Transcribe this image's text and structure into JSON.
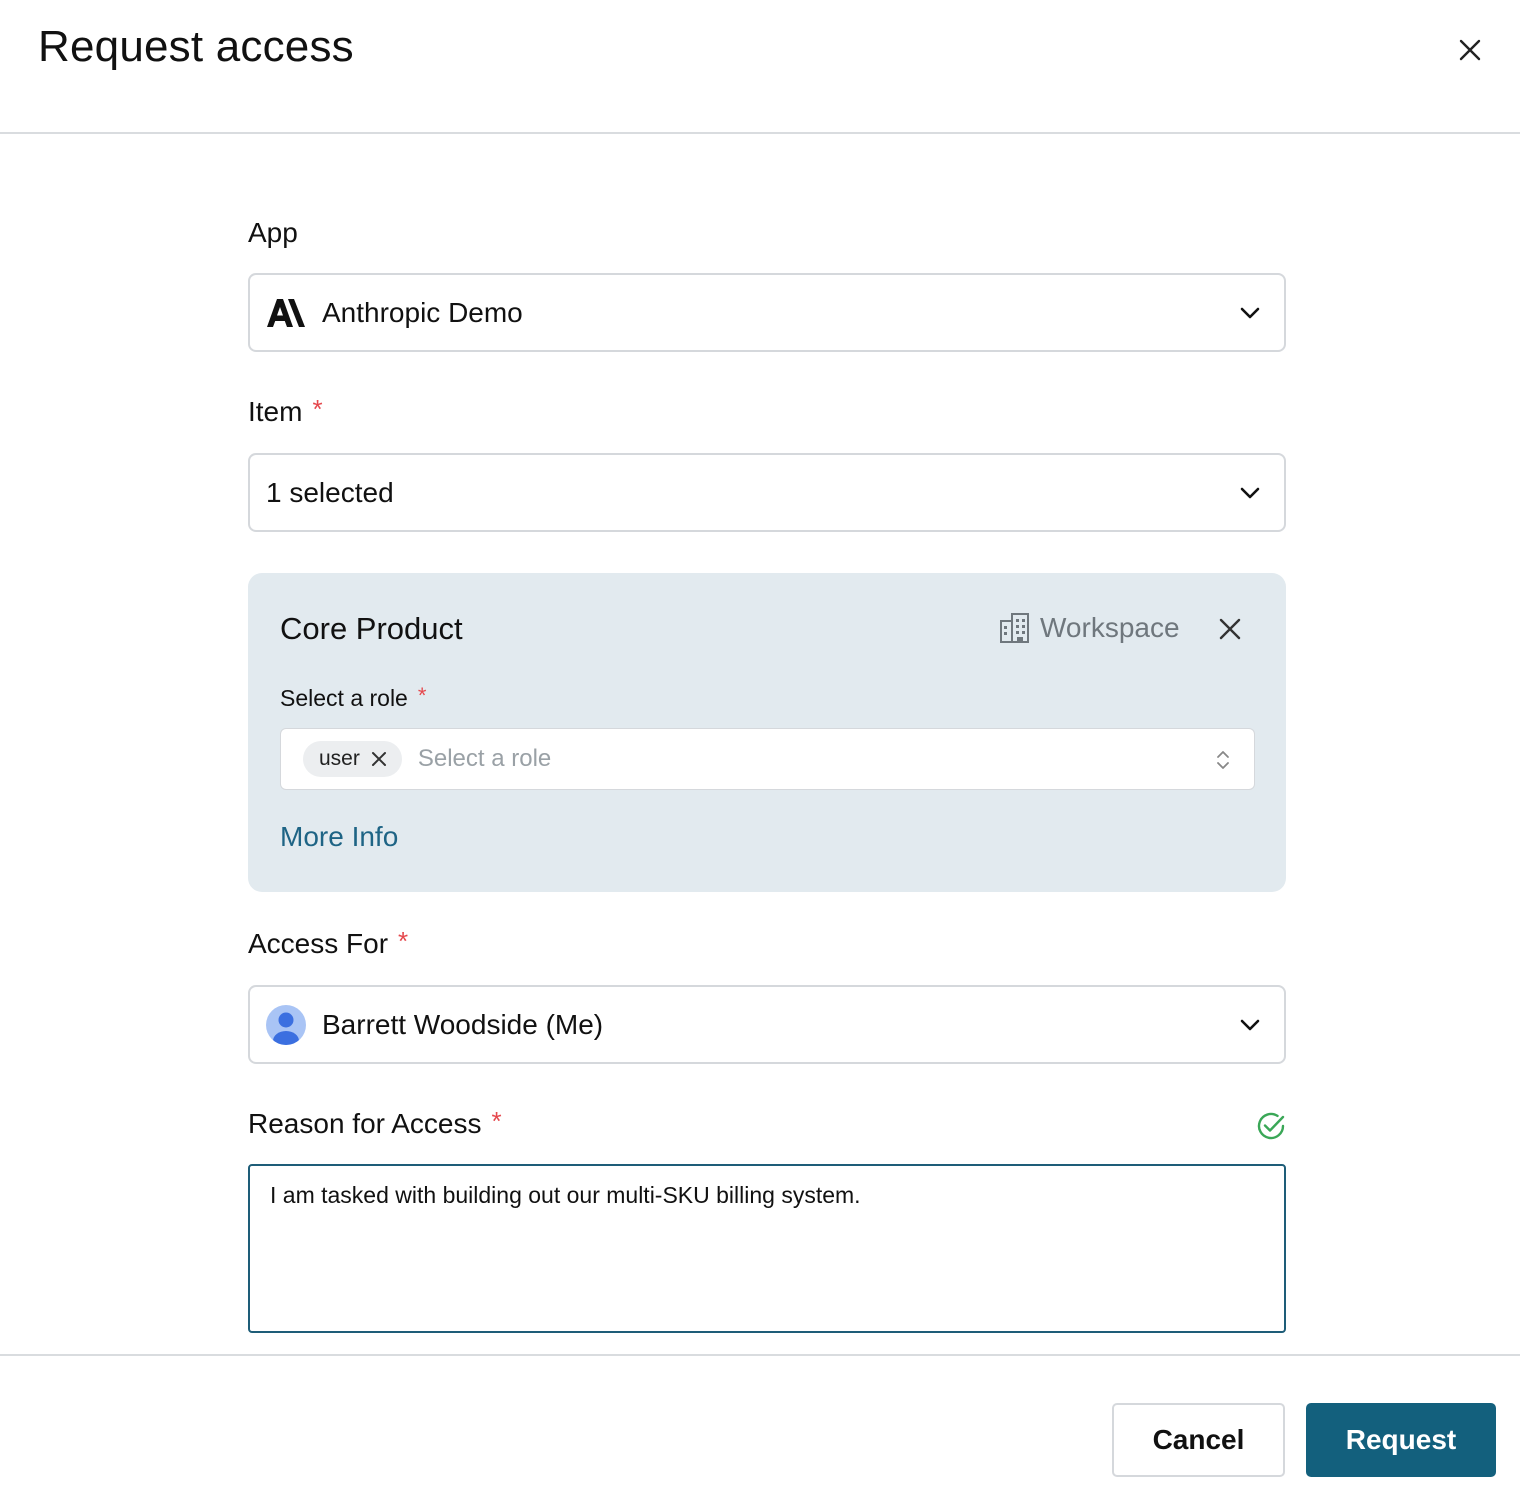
{
  "header": {
    "title": "Request access"
  },
  "app_field": {
    "label": "App",
    "value": "Anthropic Demo",
    "logo_icon": "anthropic-logo"
  },
  "item_field": {
    "label": "Item",
    "required_mark": "*",
    "value": "1 selected"
  },
  "item_card": {
    "title": "Core Product",
    "type_label": "Workspace",
    "type_icon": "building-icon",
    "role_label": "Select a role",
    "required_mark": "*",
    "selected_roles": [
      "user"
    ],
    "role_placeholder": "Select a role",
    "more_info_label": "More Info"
  },
  "access_for_field": {
    "label": "Access For",
    "required_mark": "*",
    "value": "Barrett Woodside (Me)"
  },
  "reason_field": {
    "label": "Reason for Access",
    "required_mark": "*",
    "value": "I am tasked with building out our multi-SKU billing system.",
    "valid_icon": "check-circle-icon"
  },
  "footer": {
    "cancel_label": "Cancel",
    "request_label": "Request"
  },
  "colors": {
    "accent": "#13607d",
    "link": "#1e6485",
    "required": "#e5484d",
    "card_bg": "#e2eaef",
    "valid": "#3aa757"
  }
}
